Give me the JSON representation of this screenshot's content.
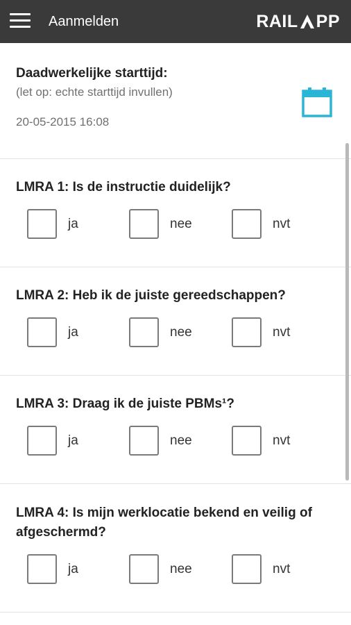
{
  "appbar": {
    "title": "Aanmelden",
    "logo_left": "RAIL",
    "logo_right": "PP"
  },
  "start": {
    "label": "Daadwerkelijke starttijd:",
    "hint": "(let op: echte starttijd invullen)",
    "value": "20-05-2015 16:08"
  },
  "options": {
    "ja": "ja",
    "nee": "nee",
    "nvt": "nvt"
  },
  "questions": [
    {
      "text": "LMRA 1: Is de instructie duidelijk?"
    },
    {
      "text": "LMRA 2: Heb ik de juiste gereedschappen?"
    },
    {
      "text": "LMRA 3: Draag ik de juiste PBMs¹?"
    },
    {
      "text": "LMRA 4: Is mijn werklocatie bekend en veilig of afgeschermd?"
    }
  ],
  "colors": {
    "appbar": "#3a3a3a",
    "calendar_accent": "#29b6d6"
  },
  "icons": {
    "menu": "hamburger-menu-icon",
    "calendar": "calendar-icon"
  }
}
